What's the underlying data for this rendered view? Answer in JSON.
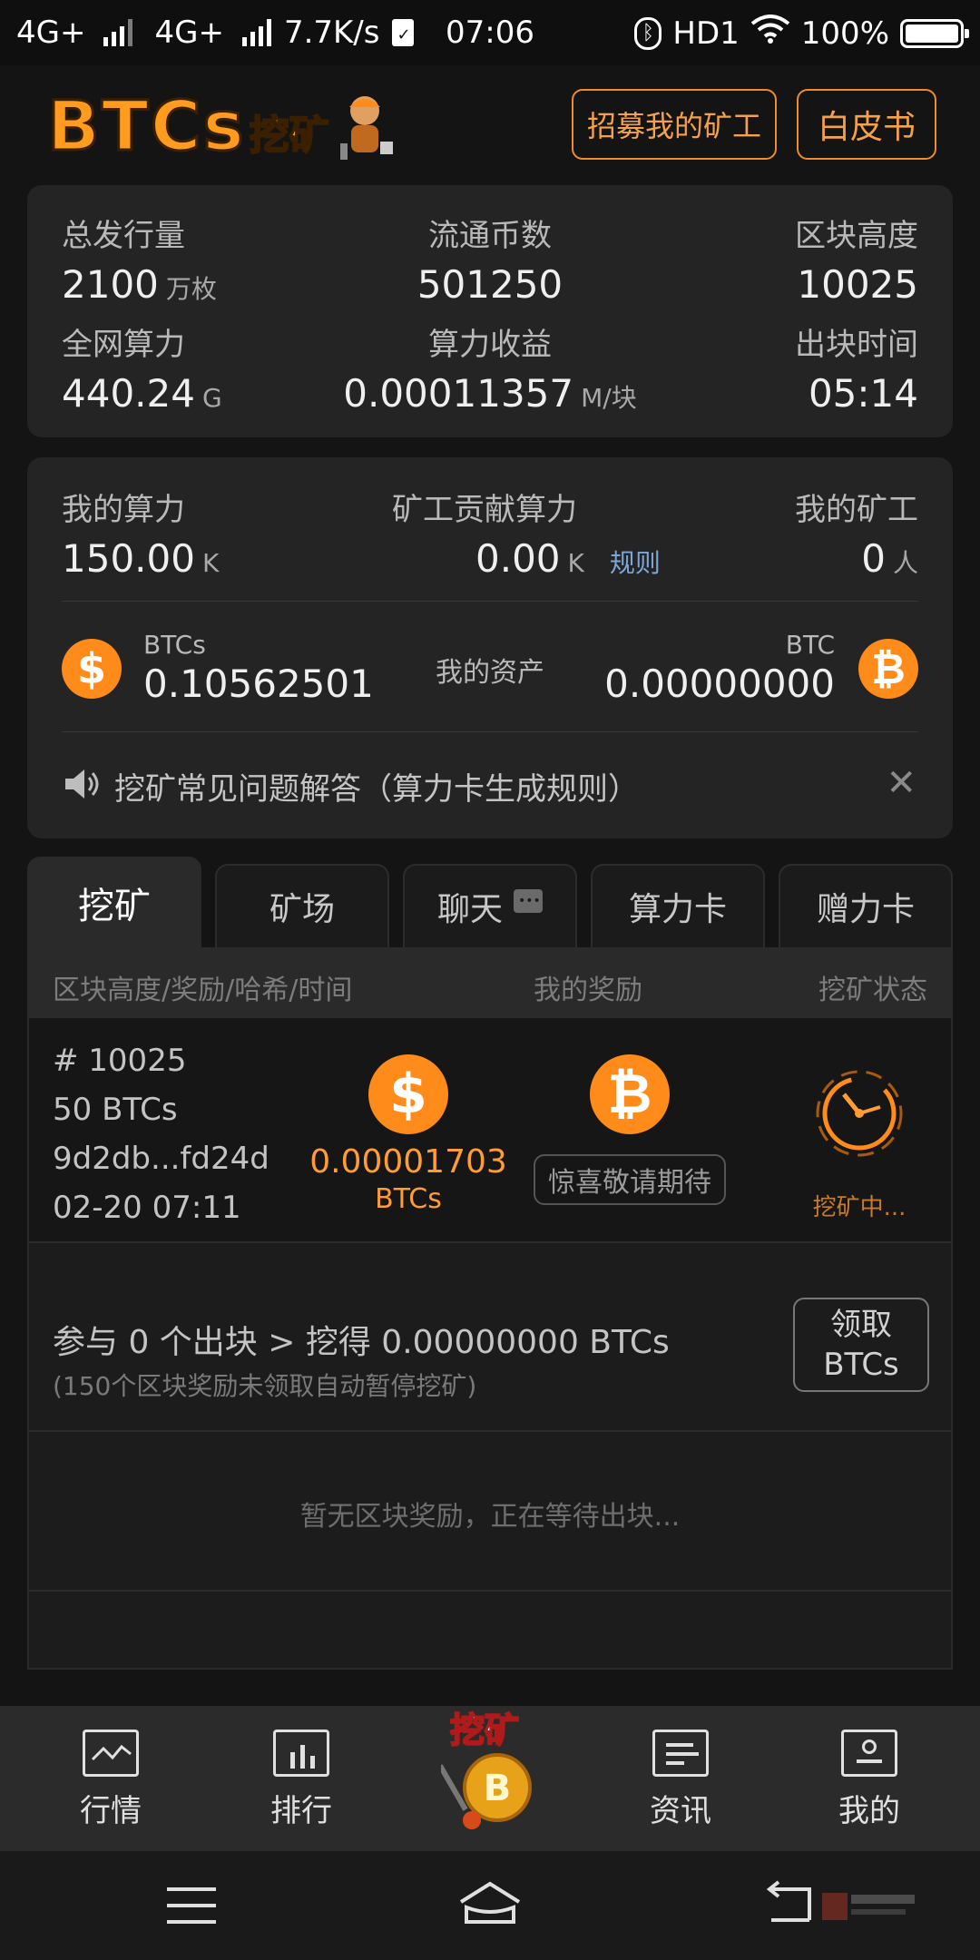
{
  "status_bar": {
    "net1": "4G+",
    "net2": "4G+",
    "speed": "7.7K/s",
    "time": "07:06",
    "hd": "HD1",
    "battery": "100%"
  },
  "header": {
    "logo_text": "BTCs",
    "logo_cn": "挖矿",
    "recruit_button": "招募我的矿工",
    "whitepaper_button": "白皮书"
  },
  "stats": {
    "total_supply_label": "总发行量",
    "total_supply_value": "2100",
    "total_supply_unit": "万枚",
    "circulation_label": "流通币数",
    "circulation_value": "501250",
    "block_height_label": "区块高度",
    "block_height_value": "10025",
    "network_hash_label": "全网算力",
    "network_hash_value": "440.24",
    "network_hash_unit": "G",
    "hash_income_label": "算力收益",
    "hash_income_value": "0.00011357",
    "hash_income_unit": "M/块",
    "block_time_label": "出块时间",
    "block_time_value": "05:14"
  },
  "my": {
    "my_hash_label": "我的算力",
    "my_hash_value": "150.00",
    "my_hash_unit": "K",
    "miner_contrib_label": "矿工贡献算力",
    "miner_contrib_value": "0.00",
    "miner_contrib_unit": "K",
    "rules_link": "规则",
    "my_miners_label": "我的矿工",
    "my_miners_value": "0",
    "my_miners_unit": "人",
    "btcs_label": "BTCs",
    "btcs_value": "0.10562501",
    "assets_label": "我的资产",
    "btc_label": "BTC",
    "btc_value": "0.00000000",
    "notice": "挖矿常见问题解答（算力卡生成规则）"
  },
  "tabs": [
    "挖矿",
    "矿场",
    "聊天",
    "算力卡",
    "赠力卡"
  ],
  "table": {
    "col1": "区块高度/奖励/哈希/时间",
    "col2": "我的奖励",
    "col3": "挖矿状态",
    "row": {
      "height": "# 10025",
      "reward": "50 BTCs",
      "hash": "9d2db...fd24d",
      "time": "02-20 07:11",
      "my_reward": "0.00001703",
      "my_reward_unit": "BTCs",
      "surprise": "惊喜敬请期待",
      "status": "挖矿中..."
    }
  },
  "claim": {
    "summary": "参与 0 个出块 > 挖得 0.00000000 BTCs",
    "note": "(150个区块奖励未领取自动暂停挖矿)",
    "button_line1": "领取",
    "button_line2": "BTCs"
  },
  "empty_text": "暂无区块奖励，正在等待出块...",
  "bottom_nav": {
    "market": "行情",
    "rank": "排行",
    "mining": "挖矿",
    "news": "资讯",
    "mine": "我的"
  },
  "coin_symbols": {
    "dollar": "$",
    "bitcoin": "₿"
  },
  "colors": {
    "accent": "#ff8c1a",
    "bg": "#141414",
    "card": "#242424"
  }
}
